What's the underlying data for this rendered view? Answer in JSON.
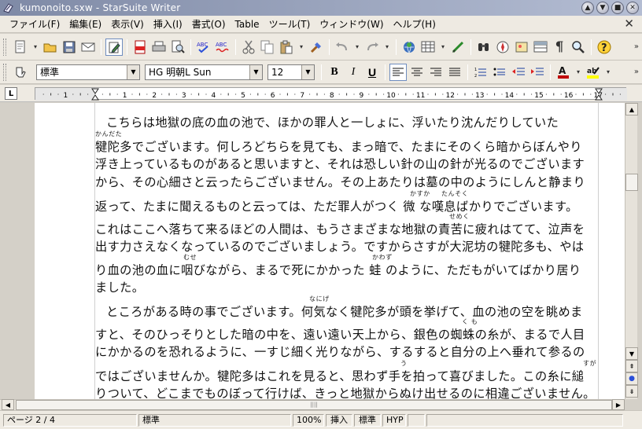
{
  "window": {
    "title": "kumonoito.sxw - StarSuite Writer"
  },
  "menu": [
    "ファイル(F)",
    "編集(E)",
    "表示(V)",
    "挿入(I)",
    "書式(O)",
    "Table",
    "ツール(T)",
    "ウィンドウ(W)",
    "ヘルプ(H)"
  ],
  "format": {
    "style": "標準",
    "font": "HG 明朝L Sun",
    "size": "12"
  },
  "ruler": {
    "labels": [
      "1",
      "1",
      "2",
      "3",
      "4",
      "5",
      "6",
      "7",
      "8",
      "9",
      "10",
      "11",
      "12",
      "13",
      "14",
      "15",
      "16",
      "17",
      "18"
    ]
  },
  "document": {
    "lines": [
      "こちらは地獄の底の血の池で、ほかの罪人と一しょに、浮いたり沈んだりしていた",
      "犍陀多でございます。何しろどちらを見ても、まっ暗で、たまにそのくら暗からぼんやり",
      "浮き上っているものがあると思いますと、それは恐しい針の山の針が光るのでございます",
      "から、その心細さと云ったらございません。その上あたりは墓の中のようにしんと静まり",
      "返って、たまに聞えるものと云っては、ただ罪人がつく 微 な嘆息ばかりでございます。",
      "これはここへ落ちて来るほどの人間は、もうさまざまな地獄の責苦に疲れはてて、泣声を",
      "出す力さえなくなっているのでございましょう。ですからさすが大泥坊の犍陀多も、やは",
      "り血の池の血に咽びながら、まるで死にかかった 蛙 のように、ただもがいてばかり居り",
      "ました。",
      "ところがある時の事でございます。何気なく犍陀多が頭を挙げて、血の池の空を眺めま",
      "すと、そのひっそりとした暗の中を、遠い遠い天上から、銀色の蜘蛛の糸が、まるで人目",
      "にかかるのを恐れるように、一すじ細く光りながら、するすると自分の上へ垂れて参るの",
      "ではございませんか。犍陀多はこれを見ると、思わず手を拍って喜びました。この糸に縋",
      "りついて、どこまでものぼって行けば、きっと地獄からぬけ出せるのに相違ございません。"
    ],
    "ruby": {
      "r1": "かんだた",
      "r4a": "かすか",
      "r4b": "たんそく",
      "r5": "せめく",
      "r7a": "むせ",
      "r7b": "かわず",
      "r9": "なにげ",
      "r10": "く も",
      "r12a": "う",
      "r12b": "すが"
    }
  },
  "status": {
    "page": "ページ 2 / 4",
    "style": "標準",
    "zoom": "100%",
    "insert": "挿入",
    "selection": "標準",
    "hyp": "HYP"
  },
  "colors": {
    "font_color": "#c00000",
    "highlight": "#ffff00"
  }
}
